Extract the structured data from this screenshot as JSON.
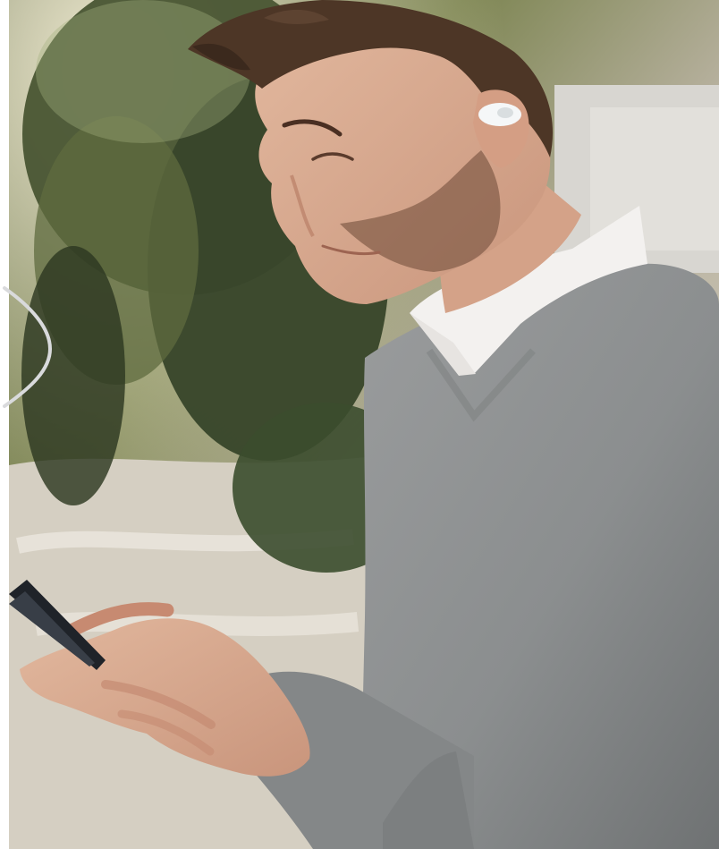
{
  "scene": {
    "subject": "man-with-earbud-and-phone",
    "icons": {
      "nav_arrow": "chevron-left-arc-icon",
      "earbud": "earbud-icon",
      "phone": "phone-icon"
    },
    "colors": {
      "sweater": "#8f9293",
      "shirt": "#f2f0ef",
      "skin": "#d7a98f",
      "hair": "#4a3424",
      "foliage_dark": "#2f3b24",
      "foliage_light": "#8a9a63",
      "pavement": "#d7d0c3",
      "sky_highlight": "#f0ebd7"
    }
  }
}
